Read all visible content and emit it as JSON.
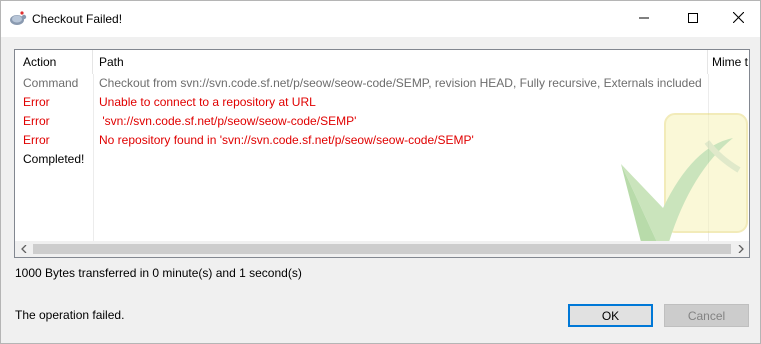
{
  "window": {
    "title": "Checkout Failed!",
    "app_icon": "tortoisesvn-icon",
    "controls": {
      "minimize": "minimize-icon",
      "maximize": "maximize-icon",
      "close": "close-icon"
    }
  },
  "table": {
    "columns": [
      "Action",
      "Path",
      "Mime t"
    ],
    "rows": [
      {
        "action": "Command",
        "path": "Checkout from svn://svn.code.sf.net/p/seow/seow-code/SEMP, revision HEAD, Fully recursive, Externals included",
        "kind": "command"
      },
      {
        "action": "Error",
        "path": "Unable to connect to a repository at URL",
        "kind": "error"
      },
      {
        "action": "Error",
        "path": " 'svn://svn.code.sf.net/p/seow/seow-code/SEMP'",
        "kind": "error"
      },
      {
        "action": "Error",
        "path": "No repository found in 'svn://svn.code.sf.net/p/seow/seow-code/SEMP'",
        "kind": "error"
      },
      {
        "action": "Completed!",
        "path": "",
        "kind": "completed"
      }
    ]
  },
  "transfer_info": "1000 Bytes transferred in 0 minute(s) and 1 second(s)",
  "status_message": "The operation failed.",
  "buttons": {
    "ok": "OK",
    "cancel": "Cancel"
  },
  "colors": {
    "error": "#e00000",
    "command": "#6d6d6d",
    "ok_border": "#0078d7"
  }
}
